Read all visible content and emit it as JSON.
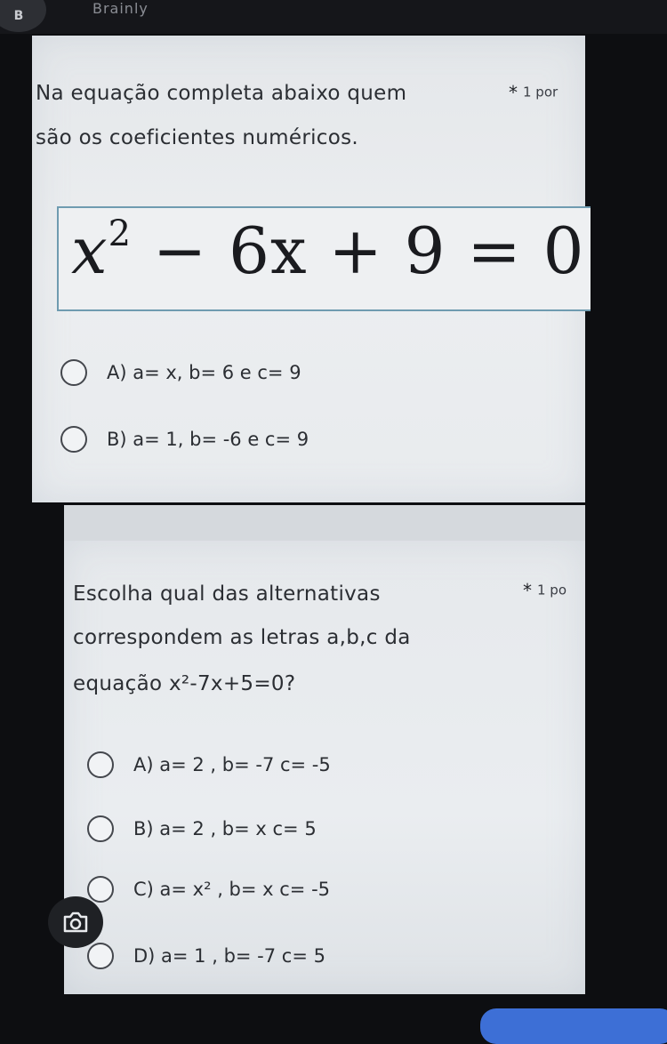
{
  "app": {
    "logo": "B",
    "name": "Brainly"
  },
  "question1": {
    "line1": "Na equação completa abaixo quem",
    "line2": "são os coeficientes numéricos.",
    "points": "1 por",
    "equation": {
      "base": "x",
      "exp": "2",
      "rest": " − 6x + 9 = 0"
    },
    "options": [
      {
        "label": "A) a= x, b= 6 e c= 9"
      },
      {
        "label": "B) a= 1, b= -6 e c= 9"
      }
    ]
  },
  "question2": {
    "line1": "Escolha qual das alternativas",
    "line2": "correspondem as letras a,b,c da",
    "line3": "equação x²-7x+5=0?",
    "points": "1 po",
    "options": [
      {
        "label": "A) a= 2  , b= -7   c= -5"
      },
      {
        "label": "B) a= 2  , b= x   c= 5"
      },
      {
        "label": "C) a= x²  , b= x   c= -5"
      },
      {
        "label": "D) a= 1  , b= -7   c= 5"
      }
    ]
  },
  "icons": {
    "camera": "camera-icon",
    "star": "required-star-icon"
  }
}
